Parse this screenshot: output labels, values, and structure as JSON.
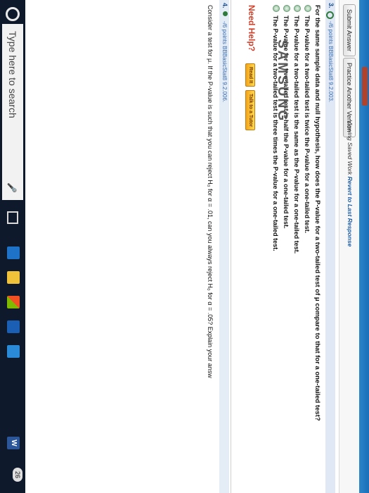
{
  "toolbar": {
    "submit_label": "Submit Answer",
    "practice_label": "Practice Another Version",
    "viewing_prefix": "Viewing Saved Work",
    "viewing_link": "Revert to Last Response"
  },
  "question3": {
    "number": "3.",
    "points_label": "-/6 points  BBBasicStat8 9.2.003.",
    "prompt": "For the same sample data and null hypothesis, how does the P-value for a two-tailed test of μ compare to that for a one-tailed test?",
    "options": [
      "The P-value for a two-tailed test is twice the P-value for a one-tailed test.",
      "The P-value for a two-tailed test is the same as the P-value for a one-tailed test.",
      "The P-value for a two-tailed test is half the P-value for a one-tailed test.",
      "The P-value for a two-tailed test is three times the P-value for a one-tailed test."
    ],
    "need_help": "Need Help?",
    "read_it": "Read It",
    "talk_tutor": "Talk to a Tutor"
  },
  "question4": {
    "number": "4.",
    "points_label": "-/6 points  BBBasicStat8 9.2.006.",
    "prompt": "Consider a test for μ. If the P-value is such that you can reject H₀ for α = .01, can you always reject H₀ for α = .05? Explain your answ"
  },
  "taskbar": {
    "search_placeholder": "Type here to search",
    "notification_count": "26"
  },
  "bezel": {
    "brand": "SAMSUNG"
  },
  "colors": {
    "header_blue": "#2c84c9",
    "link_blue": "#1d5ea8",
    "help_red": "#d0402a",
    "help_button": "#f2a61b"
  }
}
